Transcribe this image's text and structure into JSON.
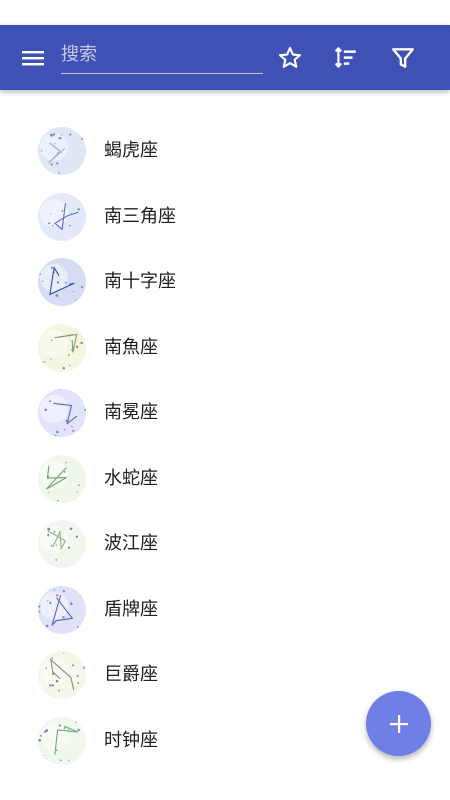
{
  "app_bar": {
    "search_placeholder": "搜索",
    "icons": [
      "menu-icon",
      "star-outline-icon",
      "sort-icon",
      "filter-icon"
    ],
    "color": "#3f51b5"
  },
  "constellations": [
    {
      "name": "蝎虎座"
    },
    {
      "name": "南三角座"
    },
    {
      "name": "南十字座"
    },
    {
      "name": "南魚座"
    },
    {
      "name": "南冕座"
    },
    {
      "name": "水蛇座"
    },
    {
      "name": "波江座"
    },
    {
      "name": "盾牌座"
    },
    {
      "name": "巨爵座"
    },
    {
      "name": "时钟座"
    }
  ],
  "fab": {
    "icon": "plus-icon",
    "color": "#6f7fe6"
  }
}
